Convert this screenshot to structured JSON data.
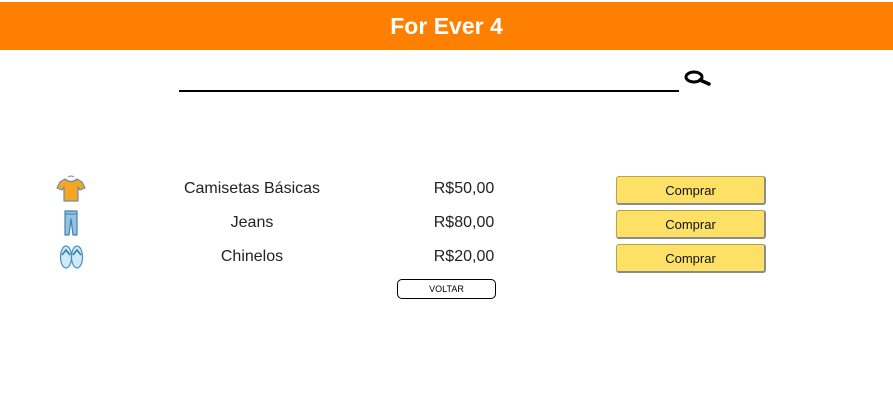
{
  "header": {
    "title": "For Ever 4",
    "color": "#ff8000"
  },
  "search": {
    "value": "",
    "placeholder": "",
    "icon": "search-icon"
  },
  "products": [
    {
      "icon": "tshirt-icon",
      "name": "Camisetas Básicas",
      "price": "R$50,00",
      "button": "Comprar"
    },
    {
      "icon": "jeans-icon",
      "name": "Jeans",
      "price": "R$80,00",
      "button": "Comprar"
    },
    {
      "icon": "flip-flops-icon",
      "name": "Chinelos",
      "price": "R$20,00",
      "button": "Comprar"
    }
  ],
  "back_button": "VOLTAR",
  "colors": {
    "buy_button": "#fce166",
    "text": "#222222"
  }
}
